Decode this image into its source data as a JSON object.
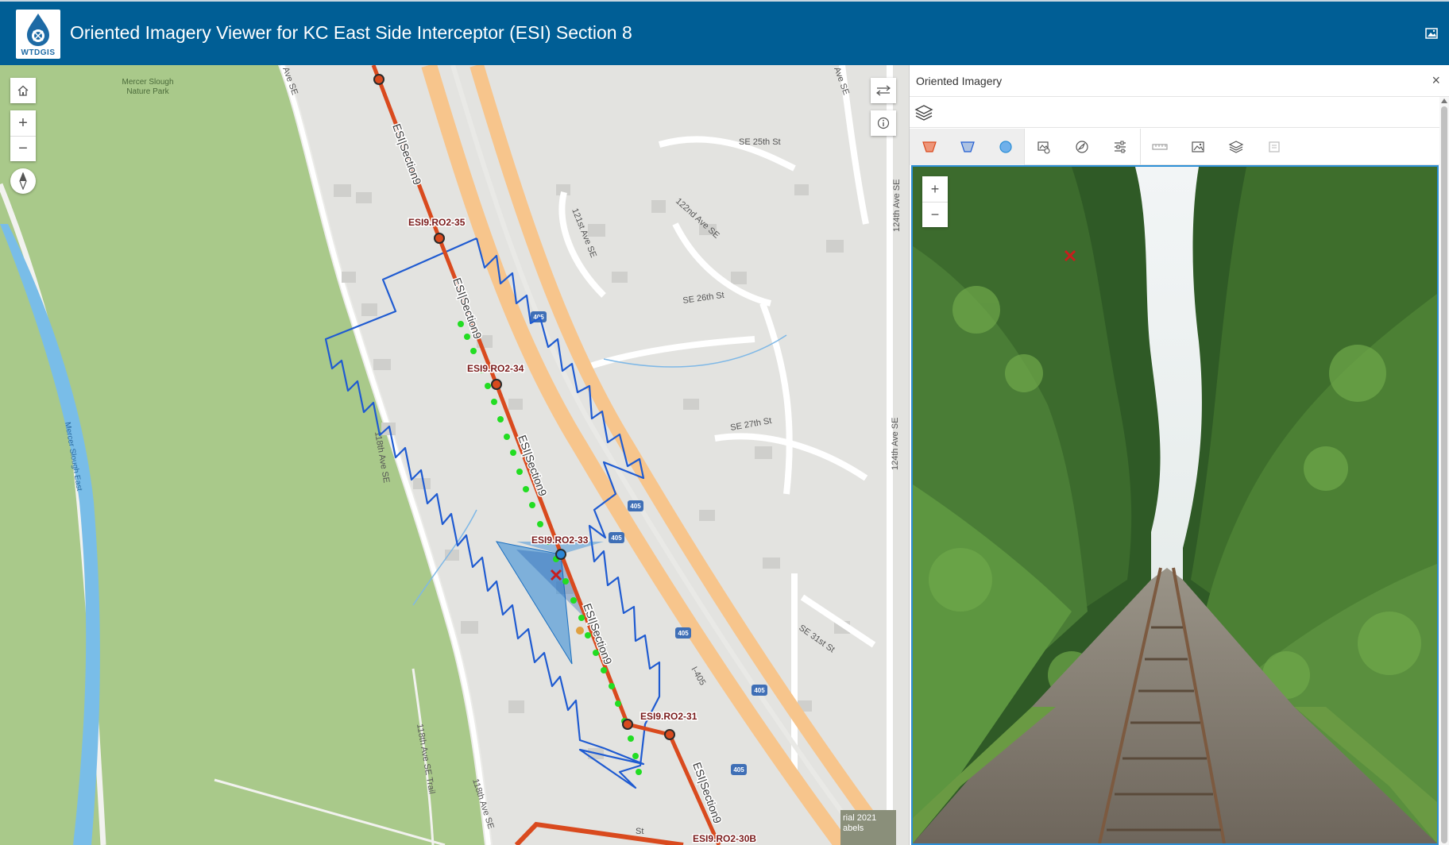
{
  "header": {
    "logo_text": "WTDGIS",
    "title": "Oriented Imagery Viewer for KC East Side Interceptor (ESI) Section 8"
  },
  "map": {
    "park_label_1": "Mercer Slough",
    "park_label_2": "Nature Park",
    "trail_label": "Mercer Slough East",
    "streets": {
      "se_25th": "SE 25th St",
      "se_26th": "SE 26th St",
      "se_27th": "SE 27th St",
      "se_31st": "SE 31st St",
      "ave_121st": "121st Ave SE",
      "ave_122nd": "122nd Ave SE",
      "ave_124th_a": "124th Ave SE",
      "ave_124th_b": "124th Ave SE",
      "ave_118th_a": "118th Ave SE",
      "ave_118th_b": "118th Ave SE",
      "trail_118th": "118th Ave SE Trail",
      "ave_se_top": "Ave SE",
      "ave_se_top2": "Ave SE",
      "i405": "I-405",
      "st_bottom": "St"
    },
    "shield": "405",
    "points": {
      "p35": "ESI9.RO2-35",
      "p34": "ESI9.RO2-34",
      "p33": "ESI9.RO2-33",
      "p31": "ESI9.RO2-31",
      "p30b": "ESI9.RO2-30B"
    },
    "line_label": "ESI|Section9",
    "attribution_1": "rial 2021",
    "attribution_2": "abels"
  },
  "panel": {
    "title": "Oriented Imagery",
    "close": "×"
  },
  "colors": {
    "header": "#005e95",
    "pipeline": "#d94a1e",
    "footprint": "#1f5bd1",
    "points_green": "#22dd22",
    "park": "#a9c98a",
    "water": "#79bde8",
    "highway": "#f7c58c",
    "accent": "#2d8fd6"
  },
  "icons": [
    "home-icon",
    "zoom-in-icon",
    "zoom-out-icon",
    "compass-icon",
    "swap-icon",
    "info-icon",
    "close-icon",
    "layers-icon",
    "footprint-icon",
    "extent-icon",
    "location-icon",
    "image-gallery-icon",
    "navigator-icon",
    "settings-icon",
    "measure-icon",
    "image-icon",
    "image-layers-icon",
    "export-icon"
  ]
}
